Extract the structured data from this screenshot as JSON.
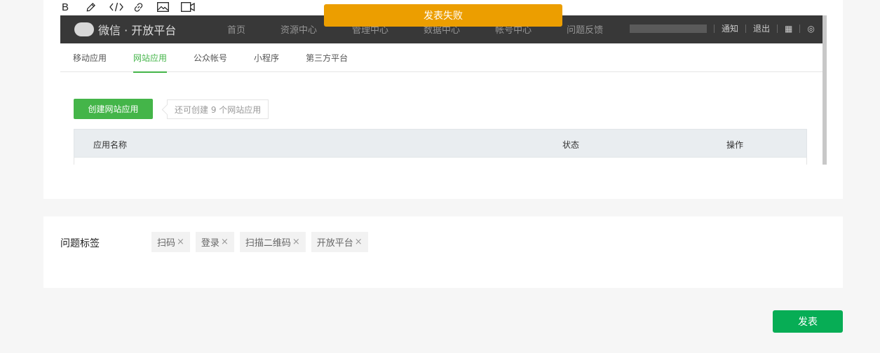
{
  "toolbar": {
    "bold_label": "B",
    "icons": [
      "pencil-icon",
      "code-icon",
      "link-icon",
      "image-icon",
      "video-icon"
    ]
  },
  "toast": {
    "message": "发表失败",
    "color": "#ec9e00"
  },
  "embedded_screenshot": {
    "brand": "微信 · 开放平台",
    "nav": [
      "首页",
      "资源中心",
      "管理中心",
      "数据中心",
      "帐号中心",
      "问题反馈"
    ],
    "header_right": [
      "通知",
      "退出"
    ],
    "tabs": [
      {
        "label": "移动应用",
        "active": false
      },
      {
        "label": "网站应用",
        "active": true
      },
      {
        "label": "公众帐号",
        "active": false
      },
      {
        "label": "小程序",
        "active": false
      },
      {
        "label": "第三方平台",
        "active": false
      }
    ],
    "create_button": "创建网站应用",
    "hint": "还可创建 9 个网站应用",
    "table_headers": {
      "name": "应用名称",
      "status": "状态",
      "action": "操作"
    }
  },
  "tags": {
    "label": "问题标签",
    "items": [
      "扫码",
      "登录",
      "扫描二维码",
      "开放平台"
    ],
    "remove_symbol": "×"
  },
  "publish": {
    "label": "发表",
    "color": "#07ad55"
  }
}
